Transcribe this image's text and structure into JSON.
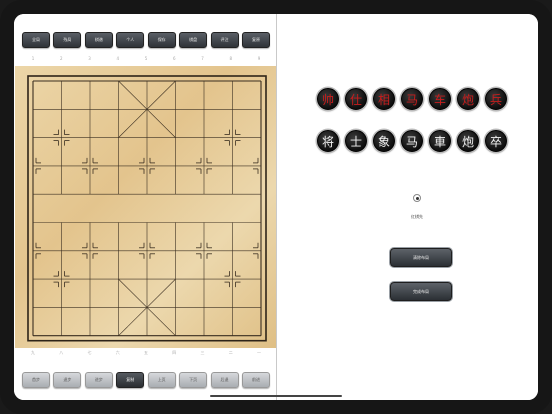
{
  "toolbar_top": [
    "全局",
    "残局",
    "棋谱",
    "个人",
    "保存",
    "棋盘",
    "评注",
    "复原"
  ],
  "toolbar_bottom": [
    {
      "label": "首步",
      "active": false
    },
    {
      "label": "退步",
      "active": false
    },
    {
      "label": "进步",
      "active": false
    },
    {
      "label": "复制",
      "active": true
    },
    {
      "label": "上页",
      "active": false
    },
    {
      "label": "下页",
      "active": false
    },
    {
      "label": "后退",
      "active": false
    },
    {
      "label": "前进",
      "active": false
    }
  ],
  "coords_top": [
    "1",
    "2",
    "3",
    "4",
    "5",
    "6",
    "7",
    "8",
    "9"
  ],
  "coords_bottom": [
    "九",
    "八",
    "七",
    "六",
    "五",
    "四",
    "三",
    "二",
    "一"
  ],
  "red_pieces": [
    "帅",
    "仕",
    "相",
    "马",
    "车",
    "炮",
    "兵"
  ],
  "black_pieces": [
    "将",
    "士",
    "象",
    "马",
    "車",
    "炮",
    "卒"
  ],
  "side_label": "红棋先",
  "buttons": {
    "clear": "清除布局",
    "finish": "完成布局"
  },
  "colors": {
    "red_piece_text": "#c81d1d",
    "black_piece_text": "#f2f2f2",
    "board": "#e8cf9d"
  }
}
